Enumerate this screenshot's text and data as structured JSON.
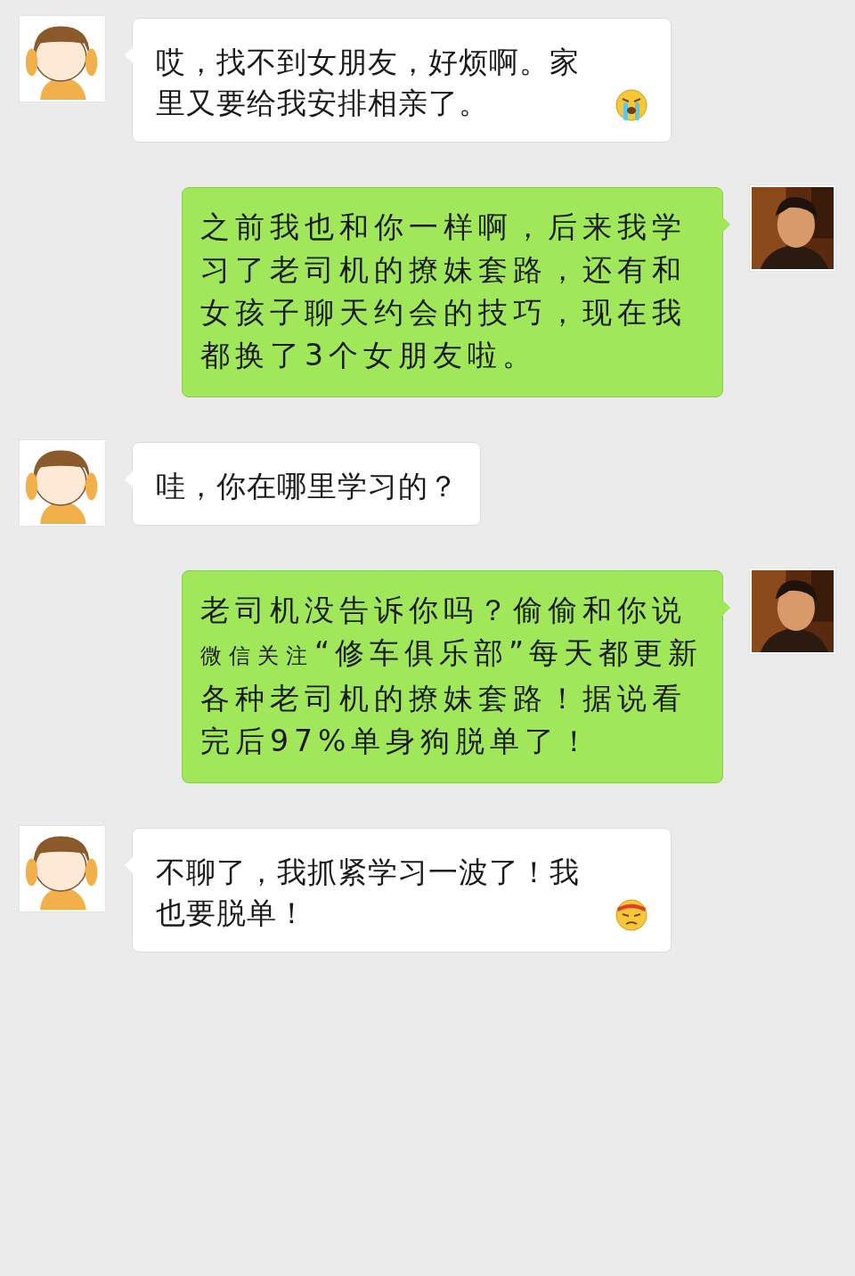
{
  "messages": [
    {
      "outgoing": false,
      "avatar": {
        "kind": "cartoon"
      },
      "parts": [
        {
          "kind": "text",
          "text": "哎，找不到女朋友，好烦啊。家里又要给我安排相亲了。"
        },
        {
          "kind": "cry"
        }
      ]
    },
    {
      "outgoing": true,
      "avatar": {
        "kind": "picture"
      },
      "parts": [
        {
          "kind": "text",
          "text": "之前我也和你一样啊，后来我学习了老司机的撩妹套路，还有和女孩子聊天约会的技巧，现在我都换了3个女朋友啦。"
        }
      ]
    },
    {
      "outgoing": false,
      "avatar": {
        "kind": "cartoon"
      },
      "parts": [
        {
          "kind": "text",
          "text": "哇，你在哪里学习的？"
        }
      ]
    },
    {
      "outgoing": true,
      "avatar": {
        "kind": "picture"
      },
      "parts": [
        {
          "kind": "text",
          "text": "老司机没告诉你吗？偷偷和你说"
        },
        {
          "kind": "small",
          "text": "微信关注"
        },
        {
          "kind": "text",
          "text": "“修车俱乐部”每天都更新各种老司机的撩妹套路！据说看完后97%单身狗脱单了！"
        }
      ]
    },
    {
      "outgoing": false,
      "avatar": {
        "kind": "cartoon"
      },
      "parts": [
        {
          "kind": "text",
          "text": "不聊了，我抓紧学习一波了！我也要脱单！"
        },
        {
          "kind": "scowl"
        }
      ]
    }
  ]
}
